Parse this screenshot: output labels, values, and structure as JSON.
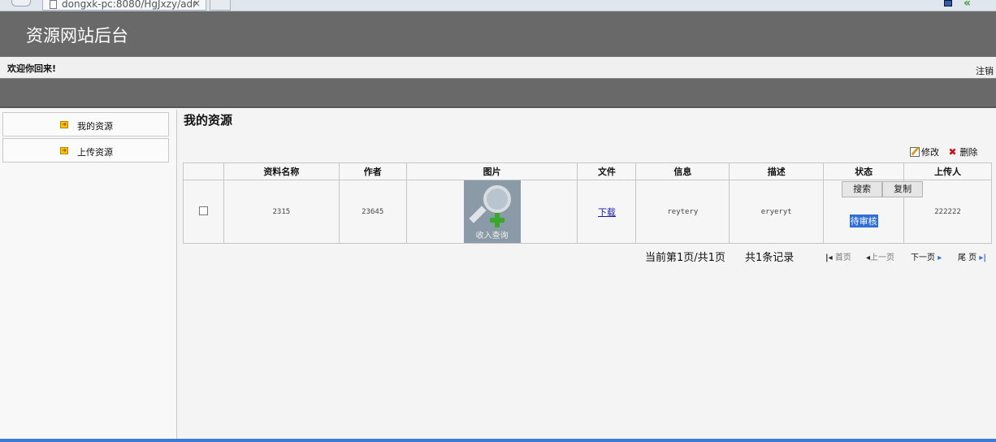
{
  "browser": {
    "tab_title": "dongxk-pc:8080/HgJxzy/adr",
    "tab_close": "×"
  },
  "header": {
    "site_title": "资源网站后台",
    "welcome": "欢迎你回来!",
    "logout": "注销"
  },
  "sidebar": {
    "items": [
      {
        "label": "我的资源"
      },
      {
        "label": "上传资源"
      }
    ]
  },
  "main": {
    "title": "我的资源",
    "toolbar": {
      "edit_label": "修改",
      "delete_label": "删除"
    },
    "table": {
      "columns": [
        "资料名称",
        "作者",
        "图片",
        "文件",
        "信息",
        "描述",
        "状态",
        "上传人"
      ],
      "rows": [
        {
          "name": "2315",
          "author": "23645",
          "image_caption": "收入查询",
          "file_link": "下载",
          "info": "reytery",
          "description": "eryeryt",
          "status": "待审核",
          "uploader": "222222"
        }
      ],
      "status_actions": [
        "搜索",
        "复制"
      ]
    },
    "pagination": {
      "summary": "当前第1页/共1页",
      "record_count": "共1条记录",
      "first": "首页",
      "prev": "上一页",
      "next": "下一页",
      "last": "尾 页"
    }
  },
  "colors": {
    "banner": "#696969",
    "status_highlight": "#2f6fd6",
    "link": "#1a1aa0"
  }
}
